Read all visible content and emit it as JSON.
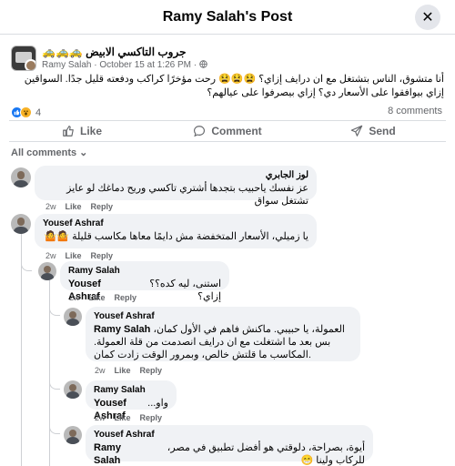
{
  "header": {
    "title": "Ramy Salah's Post",
    "close_glyph": "✕"
  },
  "post": {
    "group_name": "🚕🚕🚕 جروب التاكسي الابيض",
    "author": "Ramy Salah",
    "time": "October 15 at 1:26 PM",
    "separator": "·",
    "audience_icon": "globe-icon",
    "text": "أنا متشوق، الناس بتشتغل مع ان درايف إزاي؟ 😫😫😫 رحت مؤخرًا كراكب ودفعته قليل جدًا. السواقين إزاي بيوافقوا على الأسعار دي؟ إزاي بيصرفوا على عيالهم؟",
    "reaction_count": "4",
    "comment_count": "8 comments"
  },
  "actions": {
    "like": "Like",
    "comment": "Comment",
    "send": "Send"
  },
  "filter_label": "All comments ⌄",
  "comments": [
    {
      "name": "لوز الجابري",
      "text": "عز نفسك ياحبيب بتجدها أشتري تاكسي وريح دماغك لو عايز تشتغل سواق",
      "time": "2w",
      "like": "Like",
      "reply": "Reply"
    },
    {
      "name": "Yousef Ashraf",
      "text": "يا زميلي، الأسعار المتخفضة مش دايمًا معاها مكاسب قليلة 🤷🤷",
      "time": "2w",
      "like": "Like",
      "reply": "Reply"
    },
    {
      "name": "Ramy Salah",
      "mention": "Yousef Ashraf",
      "text": "استنى، ليه كده؟؟ إزاي؟",
      "time": "2w",
      "like": "Like",
      "reply": "Reply"
    },
    {
      "name": "Yousef Ashraf",
      "mention": "Ramy Salah",
      "text": "العمولة، يا حبيبي. ماكنش فاهم في الأول كمان، بس بعد ما اشتغلت مع ان درايف انصدمت من قلة العمولة. المكاسب ما قلتش خالص، وبمرور الوقت زادت كمان.",
      "time": "2w",
      "like": "Like",
      "reply": "Reply"
    },
    {
      "name": "Ramy Salah",
      "mention": "Yousef Ashraf",
      "text": "واو...",
      "time": "2w",
      "like": "Like",
      "reply": "Reply"
    },
    {
      "name": "Yousef Ashraf",
      "mention": "Ramy Salah",
      "text": "أيوة، بصراحة، دلوقتي هو أفضل تطبيق في مصر، للركاب ولينا 😁"
    }
  ]
}
